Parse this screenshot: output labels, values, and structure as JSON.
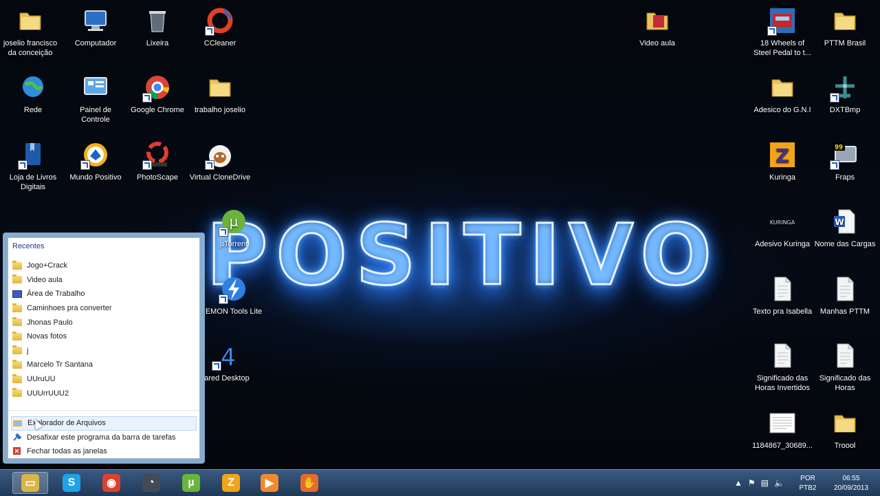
{
  "brand_logo": "POSITIVO",
  "desktop_icons": [
    {
      "id": "joselio",
      "label": "joselio francisco da conceição",
      "icon": "user-folder-icon"
    },
    {
      "id": "computador",
      "label": "Computador",
      "icon": "computer-icon"
    },
    {
      "id": "lixeira",
      "label": "Lixeira",
      "icon": "recycle-bin-icon"
    },
    {
      "id": "ccleaner",
      "label": "CCleaner",
      "icon": "ccleaner-icon"
    },
    {
      "id": "rede",
      "label": "Rede",
      "icon": "network-icon"
    },
    {
      "id": "painel",
      "label": "Painel de Controle",
      "icon": "control-panel-icon"
    },
    {
      "id": "chrome",
      "label": "Google Chrome",
      "icon": "chrome-icon"
    },
    {
      "id": "trabalho",
      "label": "trabalho joselio",
      "icon": "folder-icon"
    },
    {
      "id": "livros",
      "label": "Loja de Livros Digitais",
      "icon": "book-icon"
    },
    {
      "id": "mundo",
      "label": "Mundo Positivo",
      "icon": "mundo-positivo-icon"
    },
    {
      "id": "photoscape",
      "label": "PhotoScape",
      "icon": "photoscape-icon"
    },
    {
      "id": "clonedrive",
      "label": "Virtual CloneDrive",
      "icon": "clonedrive-sheep-icon"
    },
    {
      "id": "utorrent",
      "label": "µTorrent",
      "icon": "utorrent-icon"
    },
    {
      "id": "daemon",
      "label": "EMON Tools Lite",
      "icon": "daemon-tools-icon"
    },
    {
      "id": "shared",
      "label": "ared Desktop",
      "icon": "shared-desktop-icon"
    },
    {
      "id": "videoaula",
      "label": "Video aula",
      "icon": "video-folder-icon"
    },
    {
      "id": "18wheels",
      "label": "18 Wheels of Steel Pedal to t...",
      "icon": "truck-game-icon"
    },
    {
      "id": "pttm",
      "label": "PTTM Brasil",
      "icon": "folder-icon"
    },
    {
      "id": "adesico",
      "label": "Adesico do G.N.I",
      "icon": "folder-icon"
    },
    {
      "id": "dxtbmp",
      "label": "DXTBmp",
      "icon": "airplane-icon"
    },
    {
      "id": "kuringa",
      "label": "Kuringa",
      "icon": "kuringa-z-icon"
    },
    {
      "id": "fraps",
      "label": "Fraps",
      "icon": "fraps-icon"
    },
    {
      "id": "adesivo",
      "label": "Adesivo Kuringa",
      "icon": "kuringa-text-icon",
      "img_text": "KURINGA"
    },
    {
      "id": "nomecargas",
      "label": "Nome das Cargas",
      "icon": "word-document-icon"
    },
    {
      "id": "textoisabella",
      "label": "Texto pra Isabella",
      "icon": "text-document-icon"
    },
    {
      "id": "manhas",
      "label": "Manhas PTTM",
      "icon": "text-document-icon"
    },
    {
      "id": "sighorasinv",
      "label": "Significado das Horas Invertidos",
      "icon": "text-document-icon"
    },
    {
      "id": "sighoras",
      "label": "Significado das Horas",
      "icon": "text-document-icon"
    },
    {
      "id": "img1184867",
      "label": "1184867_30689...",
      "icon": "image-thumbnail-icon"
    },
    {
      "id": "troool",
      "label": "Troool",
      "icon": "folder-icon"
    }
  ],
  "jumplist": {
    "title": "Recentes",
    "items": [
      {
        "label": "Jogo+Crack",
        "icon": "folder-icon"
      },
      {
        "label": "Video aula",
        "icon": "folder-icon"
      },
      {
        "label": "Área de Trabalho",
        "icon": "desktop-icon"
      },
      {
        "label": "Caminhoes pra converter",
        "icon": "folder-icon"
      },
      {
        "label": "Jhonas Paulo",
        "icon": "folder-icon"
      },
      {
        "label": "Novas fotos",
        "icon": "folder-icon"
      },
      {
        "label": "j",
        "icon": "folder-icon"
      },
      {
        "label": "Marcelo Tr Santana",
        "icon": "folder-icon"
      },
      {
        "label": "UUruUU",
        "icon": "folder-icon"
      },
      {
        "label": "UUUrrUUU2",
        "icon": "folder-icon"
      }
    ],
    "actions": [
      {
        "label": "Explorador de Arquivos",
        "icon": "explorer-icon"
      },
      {
        "label": "Desafixar este programa da barra de tarefas",
        "icon": "unpin-icon"
      },
      {
        "label": "Fechar todas as janelas",
        "icon": "close-red-icon"
      }
    ]
  },
  "taskbar": {
    "apps": [
      {
        "name": "file-explorer",
        "icon": "file-explorer-icon",
        "color": "#d9b44a",
        "glyph": "▭"
      },
      {
        "name": "skype",
        "icon": "skype-icon",
        "color": "#1fa3e6",
        "glyph": "S"
      },
      {
        "name": "chrome",
        "icon": "chrome-icon",
        "color": "#d9412f",
        "glyph": "◉"
      },
      {
        "name": "photoscape",
        "icon": "photoscape-icon",
        "color": "#444a55",
        "glyph": "◔"
      },
      {
        "name": "utorrent",
        "icon": "utorrent-icon",
        "color": "#6bb33a",
        "glyph": "µ"
      },
      {
        "name": "kuringa",
        "icon": "kuringa-z-icon",
        "color": "#f2a516",
        "glyph": "Z"
      },
      {
        "name": "media-player",
        "icon": "media-player-icon",
        "color": "#f08a2a",
        "glyph": "▶"
      },
      {
        "name": "hand-app",
        "icon": "hand-icon",
        "color": "#e46a2a",
        "glyph": "✋"
      }
    ],
    "language": {
      "line1": "POR",
      "line2": "PTB2"
    },
    "clock": {
      "time": "06:55",
      "date": "20/09/2013"
    }
  }
}
